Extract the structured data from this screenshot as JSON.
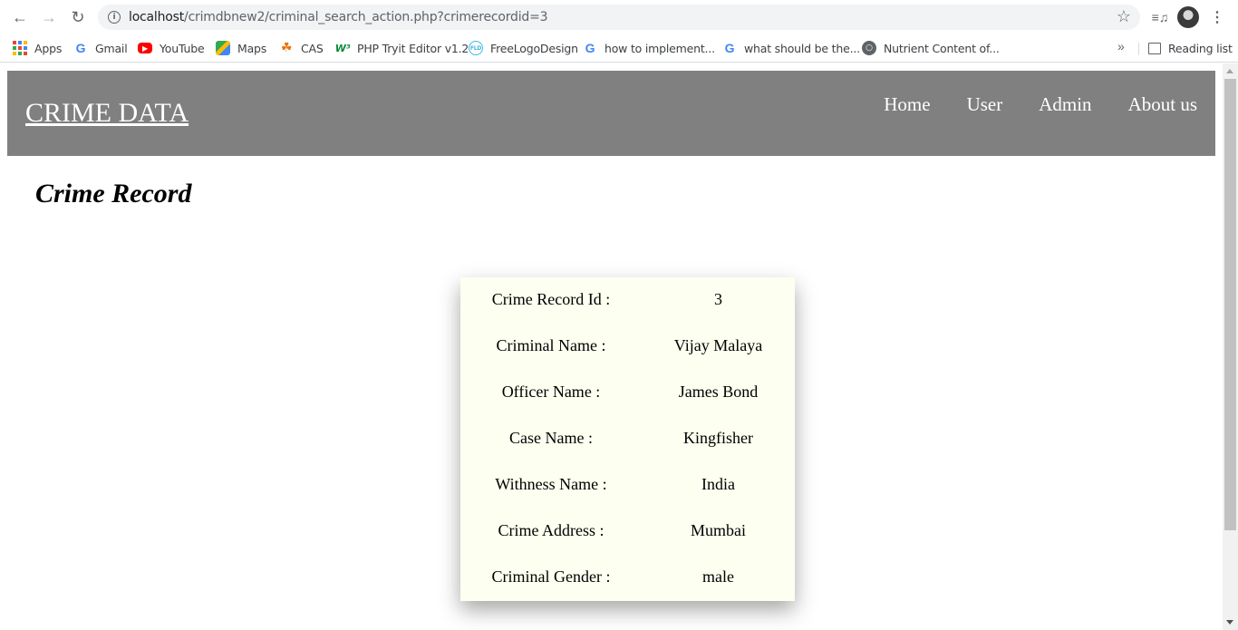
{
  "browser": {
    "url_host": "localhost",
    "url_path": "/crimdbnew2/criminal_search_action.php?crimerecordid=3",
    "bookmarks": [
      {
        "label": "Apps",
        "icon": "apps-grid-icon"
      },
      {
        "label": "Gmail",
        "icon": "google-icon"
      },
      {
        "label": "YouTube",
        "icon": "youtube-icon"
      },
      {
        "label": "Maps",
        "icon": "maps-icon"
      },
      {
        "label": "CAS",
        "icon": "cas-icon"
      },
      {
        "label": "PHP Tryit Editor v1.2",
        "icon": "w3schools-icon"
      },
      {
        "label": "FreeLogoDesign",
        "icon": "freelogodesign-icon"
      },
      {
        "label": "how to implement...",
        "icon": "google-icon"
      },
      {
        "label": "what should be the...",
        "icon": "google-icon"
      },
      {
        "label": "Nutrient Content of...",
        "icon": "globe-icon"
      }
    ],
    "reading_list_label": "Reading list",
    "more_bookmarks": "»"
  },
  "header": {
    "brand": "CRIME DATA",
    "nav": [
      "Home",
      "User",
      "Admin",
      "About us"
    ],
    "background_color": "#808080"
  },
  "main": {
    "heading": "Crime Record",
    "record": [
      {
        "label": "Crime Record Id :",
        "value": "3"
      },
      {
        "label": "Criminal Name :",
        "value": "Vijay Malaya"
      },
      {
        "label": "Officer Name :",
        "value": "James Bond"
      },
      {
        "label": "Case Name :",
        "value": "Kingfisher"
      },
      {
        "label": "Withness Name :",
        "value": "India"
      },
      {
        "label": "Crime Address :",
        "value": "Mumbai"
      },
      {
        "label": "Criminal Gender :",
        "value": "male"
      }
    ],
    "card_color": "#fdfff0"
  }
}
